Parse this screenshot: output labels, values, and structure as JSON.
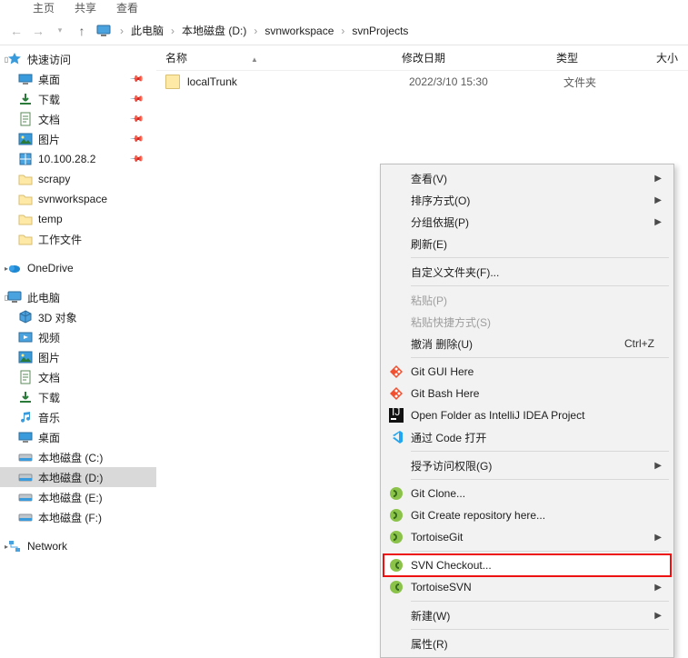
{
  "topbar": {
    "t1": "主页",
    "t2": "共享",
    "t3": "查看"
  },
  "breadcrumb": {
    "parts": [
      "此电脑",
      "本地磁盘 (D:)",
      "svnworkspace",
      "svnProjects"
    ],
    "sep": "›"
  },
  "columns": {
    "name": "名称",
    "date": "修改日期",
    "type": "类型",
    "size": "大小"
  },
  "rows": [
    {
      "name": "localTrunk",
      "date": "2022/3/10 15:30",
      "type": "文件夹"
    }
  ],
  "sidebar": {
    "quick": "快速访问",
    "items1": [
      {
        "label": "桌面",
        "pin": true,
        "icon": "desktop"
      },
      {
        "label": "下载",
        "pin": true,
        "icon": "download"
      },
      {
        "label": "文档",
        "pin": true,
        "icon": "doc"
      },
      {
        "label": "图片",
        "pin": true,
        "icon": "pic"
      },
      {
        "label": "10.100.28.2",
        "pin": true,
        "icon": "net"
      },
      {
        "label": "scrapy",
        "pin": false,
        "icon": "folder"
      },
      {
        "label": "svnworkspace",
        "pin": false,
        "icon": "folder"
      },
      {
        "label": "temp",
        "pin": false,
        "icon": "folder"
      },
      {
        "label": "工作文件",
        "pin": false,
        "icon": "folder"
      }
    ],
    "onedrive": "OneDrive",
    "thispc": "此电脑",
    "items2": [
      {
        "label": "3D 对象",
        "icon": "3d"
      },
      {
        "label": "视频",
        "icon": "video"
      },
      {
        "label": "图片",
        "icon": "pic"
      },
      {
        "label": "文档",
        "icon": "doc"
      },
      {
        "label": "下载",
        "icon": "download"
      },
      {
        "label": "音乐",
        "icon": "music"
      },
      {
        "label": "桌面",
        "icon": "desktop"
      },
      {
        "label": "本地磁盘 (C:)",
        "icon": "drive"
      },
      {
        "label": "本地磁盘 (D:)",
        "icon": "drive",
        "sel": true
      },
      {
        "label": "本地磁盘 (E:)",
        "icon": "drive"
      },
      {
        "label": "本地磁盘 (F:)",
        "icon": "drive"
      }
    ],
    "network": "Network"
  },
  "menu": {
    "groups": [
      [
        {
          "label": "查看(V)",
          "sub": true
        },
        {
          "label": "排序方式(O)",
          "sub": true
        },
        {
          "label": "分组依据(P)",
          "sub": true
        },
        {
          "label": "刷新(E)"
        }
      ],
      [
        {
          "label": "自定义文件夹(F)..."
        }
      ],
      [
        {
          "label": "粘贴(P)",
          "disabled": true
        },
        {
          "label": "粘贴快捷方式(S)",
          "disabled": true
        },
        {
          "label": "撤消 删除(U)",
          "shortcut": "Ctrl+Z"
        }
      ],
      [
        {
          "label": "Git GUI Here",
          "icon": "git"
        },
        {
          "label": "Git Bash Here",
          "icon": "git"
        },
        {
          "label": "Open Folder as IntelliJ IDEA Project",
          "icon": "ij"
        },
        {
          "label": "通过 Code 打开",
          "icon": "vsc"
        }
      ],
      [
        {
          "label": "授予访问权限(G)",
          "sub": true
        }
      ],
      [
        {
          "label": "Git Clone...",
          "icon": "tgit"
        },
        {
          "label": "Git Create repository here...",
          "icon": "tgit"
        },
        {
          "label": "TortoiseGit",
          "icon": "tgit",
          "sub": true
        }
      ],
      [
        {
          "label": "SVN Checkout...",
          "icon": "tsvn",
          "highlight": true
        },
        {
          "label": "TortoiseSVN",
          "icon": "tsvn",
          "sub": true
        }
      ],
      [
        {
          "label": "新建(W)",
          "sub": true
        }
      ],
      [
        {
          "label": "属性(R)"
        }
      ]
    ]
  }
}
